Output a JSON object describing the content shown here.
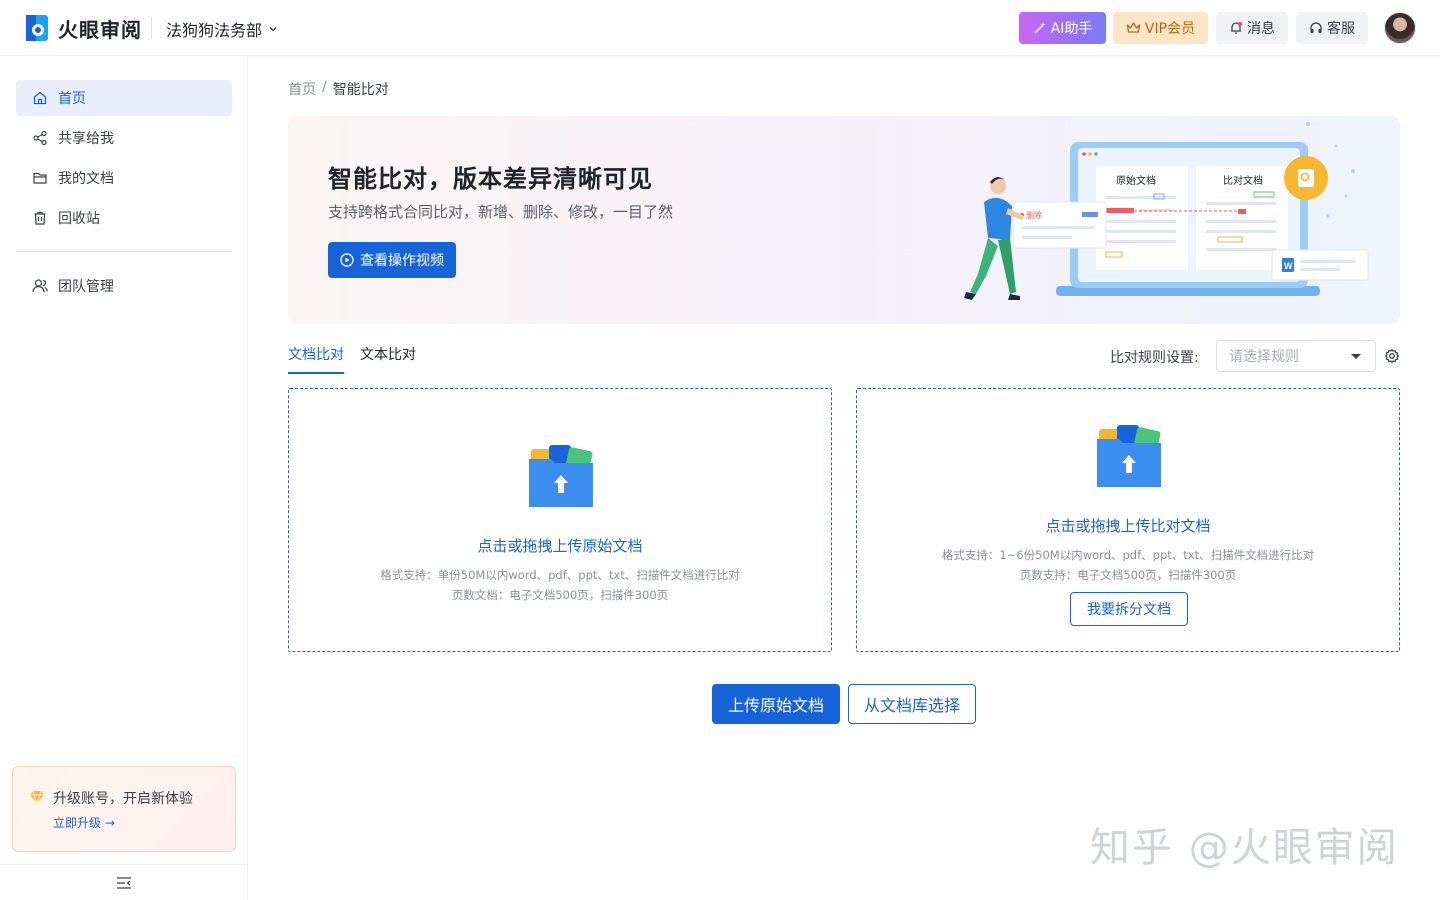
{
  "app": {
    "name": "火眼审阅",
    "org": "法狗狗法务部"
  },
  "header": {
    "ai_label": "AI助手",
    "vip_label": "VIP会员",
    "msg_label": "消息",
    "service_label": "客服"
  },
  "sidebar": {
    "items": [
      {
        "label": "首页",
        "icon": "home-icon",
        "active": true
      },
      {
        "label": "共享给我",
        "icon": "share-icon"
      },
      {
        "label": "我的文档",
        "icon": "folder-icon"
      },
      {
        "label": "回收站",
        "icon": "trash-icon"
      }
    ],
    "team": {
      "label": "团队管理",
      "icon": "team-icon"
    },
    "upgrade": {
      "title": "升级账号，开启新体验",
      "link": "立即升级"
    }
  },
  "breadcrumb": {
    "home": "首页",
    "sep": "/",
    "current": "智能比对"
  },
  "banner": {
    "title": "智能比对，版本差异清晰可见",
    "subtitle": "支持跨格式合同比对，新增、删除、修改，一目了然",
    "button": "查看操作视频",
    "art": {
      "left_doc": "原始文档",
      "right_doc": "比对文档",
      "tag": "删除"
    }
  },
  "tabs": [
    {
      "label": "文档比对",
      "active": true
    },
    {
      "label": "文本比对",
      "active": false
    }
  ],
  "rules": {
    "label": "比对规则设置:",
    "placeholder": "请选择规则"
  },
  "upload_left": {
    "title": "点击或拖拽上传原始文档",
    "note1": "格式支持：单份50M以内word、pdf、ppt、txt、扫描件文档进行比对",
    "note2": "页数文档：电子文档500页，扫描件300页"
  },
  "upload_right": {
    "title": "点击或拖拽上传比对文档",
    "note1": "格式支持：1~6份50M以内word、pdf、ppt、txt、扫描件文档进行比对",
    "note2": "页数支持：电子文档500页，扫描件300页",
    "split_button": "我要拆分文档"
  },
  "actions": {
    "upload_original": "上传原始文档",
    "choose_library": "从文档库选择"
  },
  "watermark": "知乎 @火眼审阅",
  "colors": {
    "primary": "#1764d8",
    "accent_purple": "#b26cf3",
    "vip_bg": "#fde6c8"
  }
}
